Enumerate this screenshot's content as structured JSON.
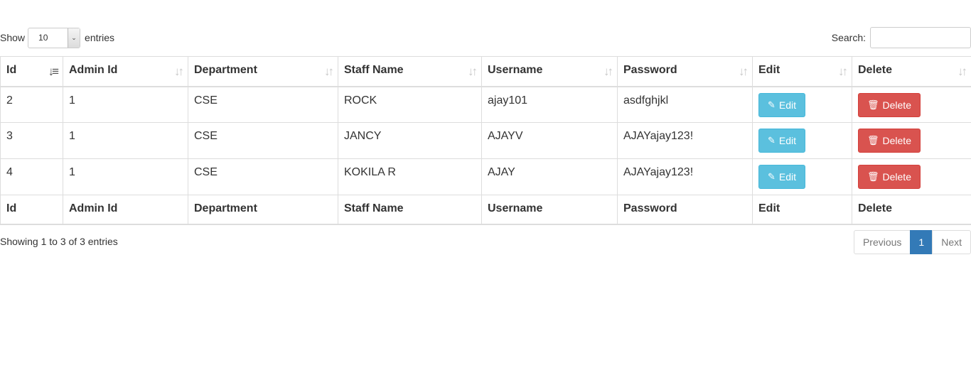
{
  "length_menu": {
    "show_label": "Show",
    "selected": "10",
    "entries_label": "entries"
  },
  "search": {
    "label": "Search:",
    "value": ""
  },
  "columns": [
    "Id",
    "Admin Id",
    "Department",
    "Staff Name",
    "Username",
    "Password",
    "Edit",
    "Delete"
  ],
  "rows": [
    {
      "id": "2",
      "admin_id": "1",
      "department": "CSE",
      "staff_name": "ROCK",
      "username": "ajay101",
      "password": "asdfghjkl",
      "edit": "Edit",
      "delete": "Delete"
    },
    {
      "id": "3",
      "admin_id": "1",
      "department": "CSE",
      "staff_name": "JANCY",
      "username": "AJAYV",
      "password": "AJAYajay123!",
      "edit": "Edit",
      "delete": "Delete"
    },
    {
      "id": "4",
      "admin_id": "1",
      "department": "CSE",
      "staff_name": "KOKILA R",
      "username": "AJAY",
      "password": "AJAYajay123!",
      "edit": "Edit",
      "delete": "Delete"
    }
  ],
  "info": "Showing 1 to 3 of 3 entries",
  "pagination": {
    "previous": "Previous",
    "current": "1",
    "next": "Next"
  },
  "icons": {
    "sort": "sort-icon",
    "sort_active": "sort-asc-icon",
    "edit": "edit-icon",
    "delete": "trash-icon"
  },
  "colors": {
    "edit_button": "#5bc0de",
    "delete_button": "#d9534f",
    "current_page": "#337ab7"
  }
}
